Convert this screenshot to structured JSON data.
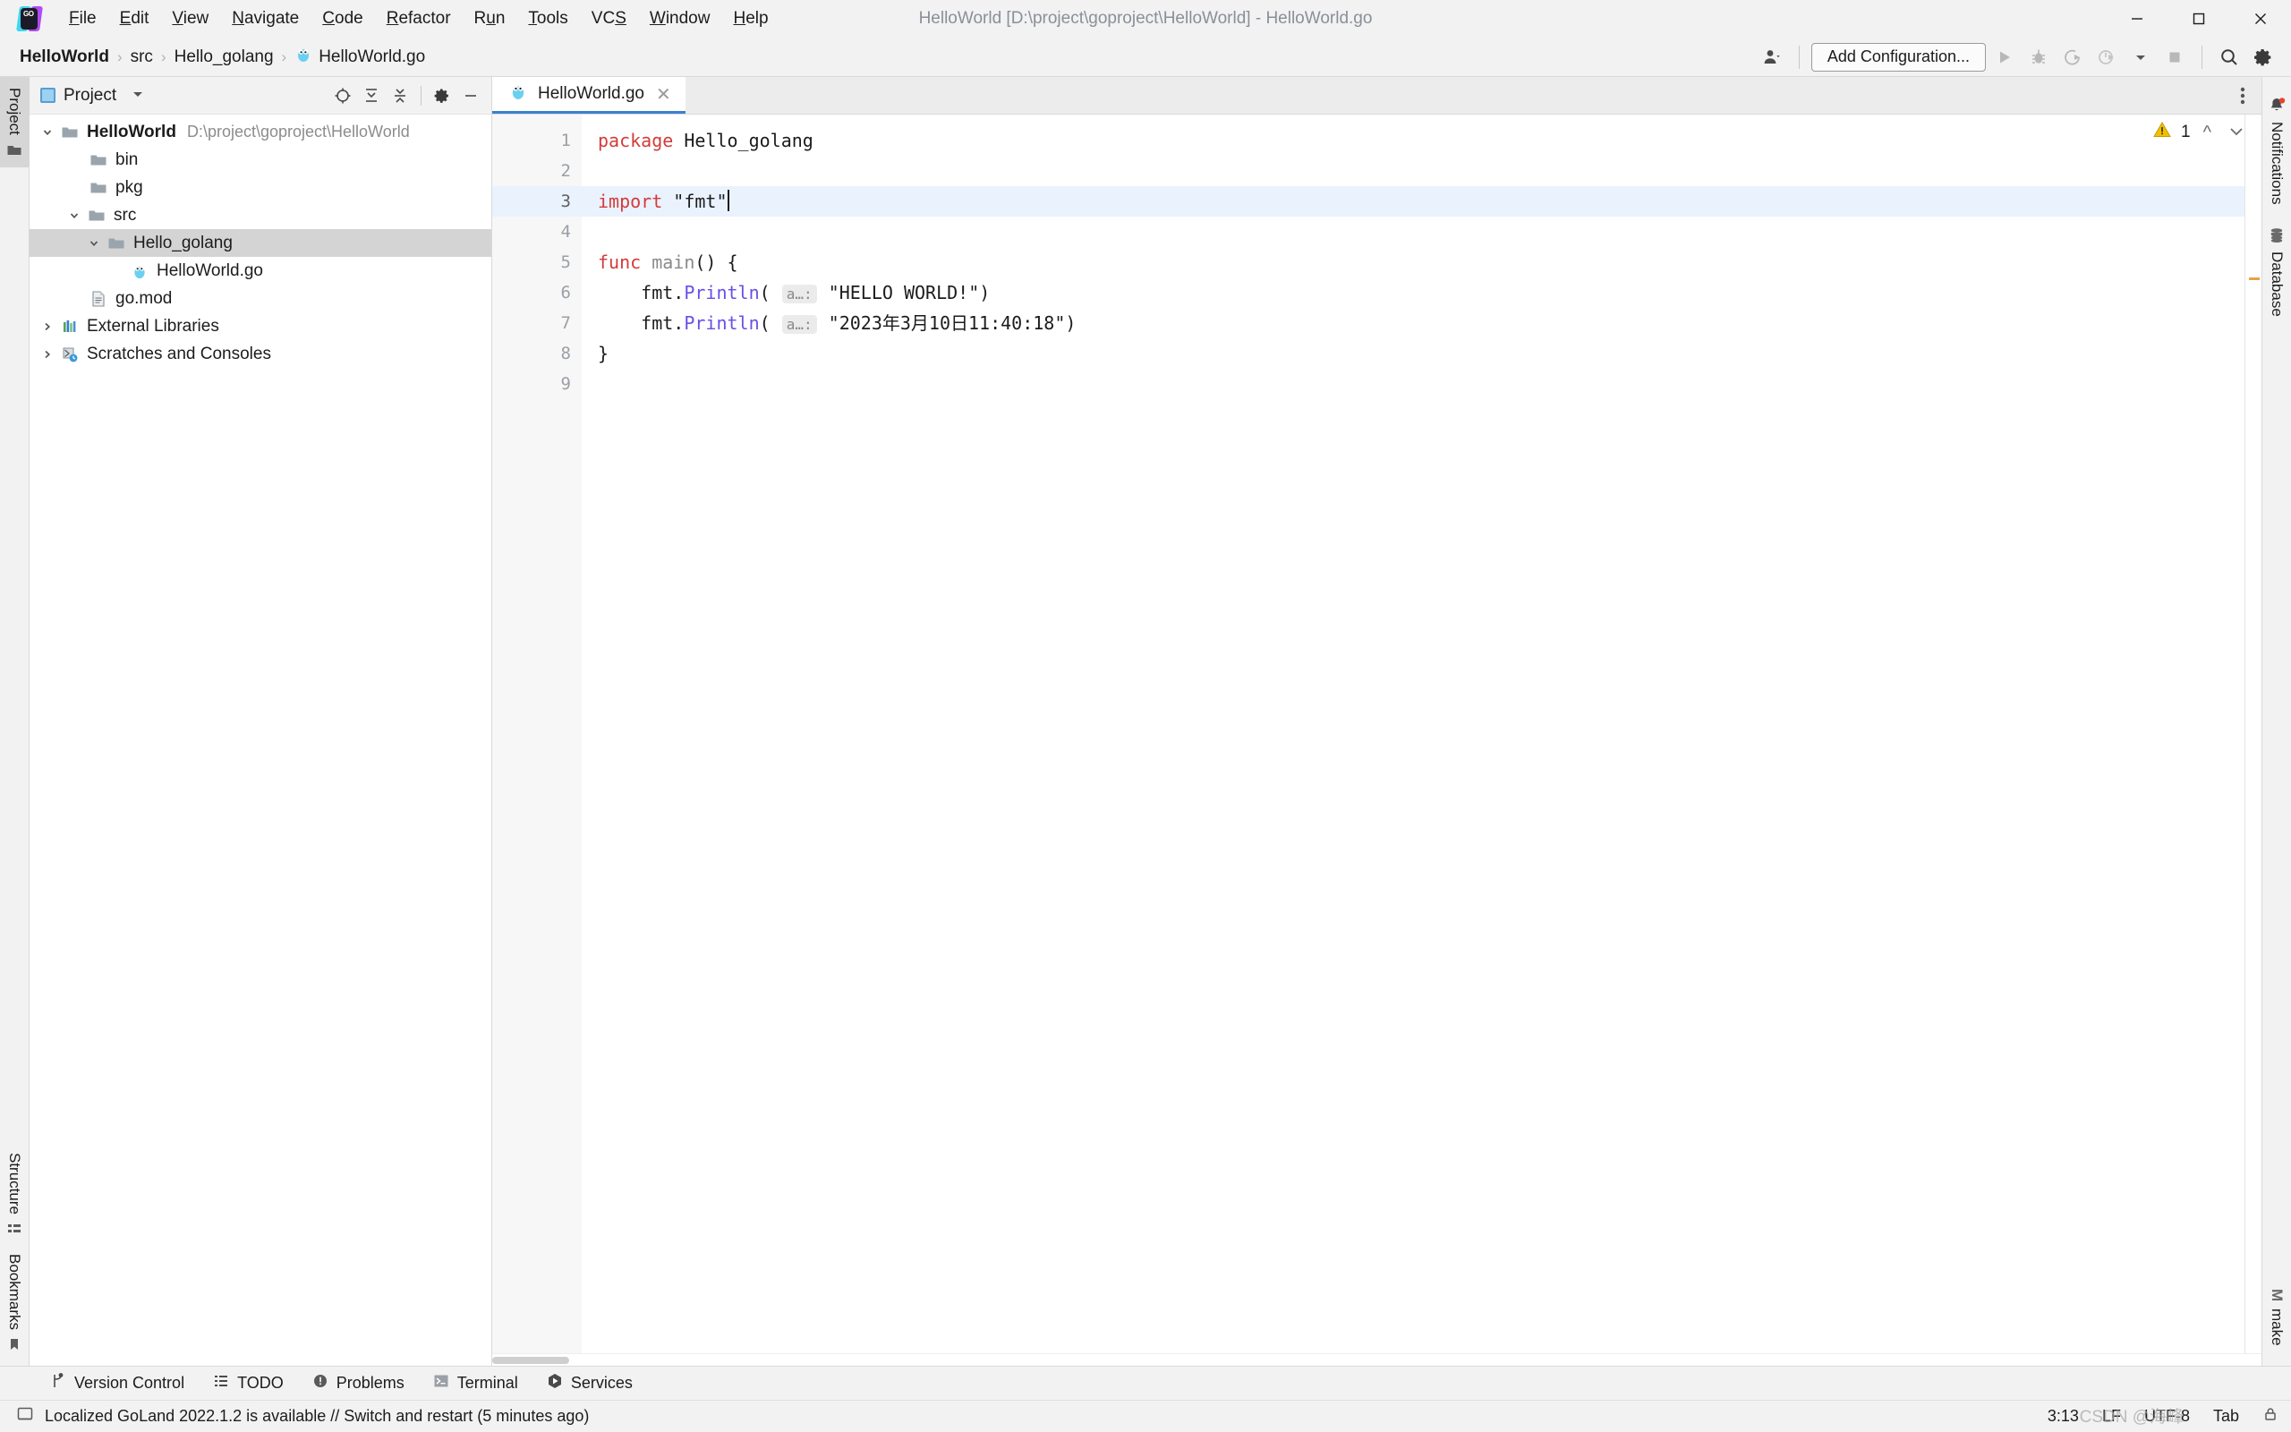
{
  "window": {
    "title": "HelloWorld [D:\\project\\goproject\\HelloWorld] - HelloWorld.go",
    "logo": "goland-logo-icon",
    "controls": {
      "minimize": "minimize-icon",
      "maximize": "maximize-icon",
      "close": "close-icon"
    }
  },
  "menubar": {
    "items": [
      {
        "label": "File",
        "mnemonic": "F"
      },
      {
        "label": "Edit",
        "mnemonic": "E"
      },
      {
        "label": "View",
        "mnemonic": "V"
      },
      {
        "label": "Navigate",
        "mnemonic": "N"
      },
      {
        "label": "Code",
        "mnemonic": "C"
      },
      {
        "label": "Refactor",
        "mnemonic": "R"
      },
      {
        "label": "Run",
        "mnemonic": "u"
      },
      {
        "label": "Tools",
        "mnemonic": "T"
      },
      {
        "label": "VCS",
        "mnemonic": "S"
      },
      {
        "label": "Window",
        "mnemonic": "W"
      },
      {
        "label": "Help",
        "mnemonic": "H"
      }
    ]
  },
  "breadcrumb": {
    "separator": "›",
    "items": [
      {
        "label": "HelloWorld",
        "bold": true,
        "icon": ""
      },
      {
        "label": "src",
        "bold": false,
        "icon": ""
      },
      {
        "label": "Hello_golang",
        "bold": false,
        "icon": ""
      },
      {
        "label": "HelloWorld.go",
        "bold": false,
        "icon": "go-file-icon"
      }
    ]
  },
  "toolbar": {
    "account_icon": "user-account-icon",
    "add_configuration_label": "Add Configuration...",
    "run_icon": "run-icon",
    "debug_icon": "debug-icon",
    "run_coverage_icon": "run-with-coverage-icon",
    "profile_icon": "profile-icon",
    "dropdown_icon": "chevron-down-icon",
    "stop_icon": "stop-icon",
    "search_icon": "search-icon",
    "settings_icon": "gear-icon"
  },
  "left_strip": {
    "tabs": [
      {
        "label": "Project",
        "icon": "project-icon",
        "active": true
      },
      {
        "label": "Structure",
        "icon": "structure-icon",
        "active": false
      },
      {
        "label": "Bookmarks",
        "icon": "bookmarks-icon",
        "active": false
      }
    ]
  },
  "project_panel": {
    "title": "Project",
    "title_icon": "project-view-icon",
    "dropdown_icon": "chevron-down-icon",
    "actions": [
      {
        "name": "select-opened-file-icon",
        "tooltip": "Select Opened File"
      },
      {
        "name": "expand-all-icon",
        "tooltip": "Expand All"
      },
      {
        "name": "collapse-all-icon",
        "tooltip": "Collapse All"
      },
      {
        "name": "gear-icon",
        "tooltip": "Settings"
      },
      {
        "name": "hide-icon",
        "tooltip": "Hide"
      }
    ],
    "tree": [
      {
        "label": "HelloWorld",
        "path": "D:\\project\\goproject\\HelloWorld",
        "indent": 0,
        "twisty": "expanded",
        "icon": "folder-icon",
        "bold": true,
        "selected": false
      },
      {
        "label": "bin",
        "path": "",
        "indent": 1,
        "twisty": "none",
        "icon": "folder-icon",
        "bold": false,
        "selected": false
      },
      {
        "label": "pkg",
        "path": "",
        "indent": 1,
        "twisty": "none",
        "icon": "folder-icon",
        "bold": false,
        "selected": false
      },
      {
        "label": "src",
        "path": "",
        "indent": 1,
        "twisty": "expanded",
        "icon": "folder-icon",
        "bold": false,
        "selected": false
      },
      {
        "label": "Hello_golang",
        "path": "",
        "indent": 2,
        "twisty": "expanded",
        "icon": "folder-icon",
        "bold": false,
        "selected": true
      },
      {
        "label": "HelloWorld.go",
        "path": "",
        "indent": 3,
        "twisty": "none",
        "icon": "go-file-icon",
        "bold": false,
        "selected": false
      },
      {
        "label": "go.mod",
        "path": "",
        "indent": 1,
        "twisty": "none",
        "icon": "gomod-file-icon",
        "bold": false,
        "selected": false
      },
      {
        "label": "External Libraries",
        "path": "",
        "indent": 0,
        "twisty": "collapsed",
        "icon": "libraries-icon",
        "bold": false,
        "selected": false
      },
      {
        "label": "Scratches and Consoles",
        "path": "",
        "indent": 0,
        "twisty": "collapsed",
        "icon": "scratches-icon",
        "bold": false,
        "selected": false
      }
    ]
  },
  "editor": {
    "tabs": [
      {
        "label": "HelloWorld.go",
        "icon": "go-file-icon",
        "active": true,
        "close_icon": "close-icon"
      }
    ],
    "kebab_icon": "more-options-icon",
    "warning": {
      "count": "1",
      "icon": "warning-triangle-icon",
      "prev_icon": "chevron-up-icon",
      "next_icon": "chevron-down-icon"
    },
    "caret_line": 3,
    "lines": [
      "1",
      "2",
      "3",
      "4",
      "5",
      "6",
      "7",
      "8",
      "9"
    ],
    "code": [
      {
        "n": 1,
        "tokens": [
          {
            "t": "package",
            "c": "kw"
          },
          {
            "t": " Hello_golang",
            "c": "plain"
          }
        ]
      },
      {
        "n": 2,
        "tokens": [],
        "bulb": true
      },
      {
        "n": 3,
        "tokens": [
          {
            "t": "import",
            "c": "kw"
          },
          {
            "t": " ",
            "c": "plain"
          },
          {
            "t": "\"fmt\"",
            "c": "str"
          }
        ],
        "caret": true
      },
      {
        "n": 4,
        "tokens": []
      },
      {
        "n": 5,
        "tokens": [
          {
            "t": "func",
            "c": "kw"
          },
          {
            "t": " ",
            "c": "plain"
          },
          {
            "t": "main",
            "c": "dim"
          },
          {
            "t": "() {",
            "c": "plain"
          }
        ],
        "fold": "start"
      },
      {
        "n": 6,
        "tokens": [
          {
            "t": "    fmt.",
            "c": "plain"
          },
          {
            "t": "Println",
            "c": "fn"
          },
          {
            "t": "( ",
            "c": "plain"
          },
          {
            "t": "a…:",
            "c": "hint"
          },
          {
            "t": " ",
            "c": "plain"
          },
          {
            "t": "\"HELLO WORLD!\"",
            "c": "str"
          },
          {
            "t": ")",
            "c": "plain"
          }
        ]
      },
      {
        "n": 7,
        "tokens": [
          {
            "t": "    fmt.",
            "c": "plain"
          },
          {
            "t": "Println",
            "c": "fn"
          },
          {
            "t": "( ",
            "c": "plain"
          },
          {
            "t": "a…:",
            "c": "hint"
          },
          {
            "t": " ",
            "c": "plain"
          },
          {
            "t": "\"2023年3月10日11:40:18\"",
            "c": "str"
          },
          {
            "t": ")",
            "c": "plain"
          }
        ]
      },
      {
        "n": 8,
        "tokens": [
          {
            "t": "}",
            "c": "plain"
          }
        ],
        "fold": "end"
      },
      {
        "n": 9,
        "tokens": []
      }
    ]
  },
  "right_strip": {
    "tabs": [
      {
        "label": "Notifications",
        "icon": "bell-icon",
        "badge": true
      },
      {
        "label": "Database",
        "icon": "database-icon",
        "badge": false
      }
    ],
    "bottom": [
      {
        "label": "make",
        "icon": "make-icon"
      }
    ]
  },
  "toolwindow_bar": {
    "items": [
      {
        "label": "Version Control",
        "icon": "branch-icon"
      },
      {
        "label": "TODO",
        "icon": "todo-icon"
      },
      {
        "label": "Problems",
        "icon": "problems-icon"
      },
      {
        "label": "Terminal",
        "icon": "terminal-icon"
      },
      {
        "label": "Services",
        "icon": "services-icon"
      }
    ]
  },
  "statusbar": {
    "message_icon": "ide-message-icon",
    "message": "Localized GoLand 2022.1.2 is available // Switch and restart (5 minutes ago)",
    "caret_position": "3:13",
    "line_separator": "LF",
    "encoding": "UTF-8",
    "indent": "Tab",
    "lock_icon": "lock-icon",
    "watermark": "CSDN @海峰"
  },
  "colors": {
    "accent": "#3c7fd0",
    "keyword": "#d43b3b",
    "function": "#6a4ee8",
    "warning": "#e8a33d",
    "selection": "#d4d4d4",
    "caret_line": "#eaf2fd",
    "chrome": "#f2f2f2"
  }
}
